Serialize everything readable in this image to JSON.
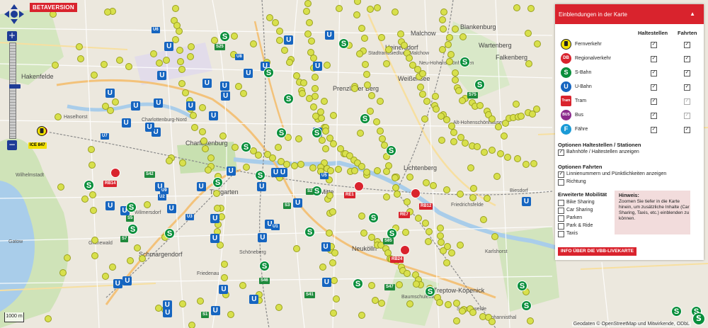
{
  "badge": "BETAVERSION",
  "scale_label": "1000 m",
  "attribution": "Geodaten © OpenStreetMap und Mitwirkende, ODbL",
  "zoom": {
    "in": "+",
    "out": "−"
  },
  "panel": {
    "title": "Einblendungen in der Karte",
    "col_stops": "Haltestellen",
    "col_trips": "Fahrten",
    "modes": [
      {
        "label": "Fernverkehr",
        "icon": "ice-icon",
        "glyph": "",
        "color": "#f2e000",
        "stops": true,
        "trips": true,
        "trips_dim": false
      },
      {
        "label": "Regionalverkehr",
        "icon": "regional-train-icon",
        "glyph": "DB",
        "color": "#d9232d",
        "stops": true,
        "trips": true,
        "trips_dim": false
      },
      {
        "label": "S-Bahn",
        "icon": "s-bahn-icon",
        "glyph": "S",
        "color": "#0a8f3c",
        "stops": true,
        "trips": true,
        "trips_dim": false
      },
      {
        "label": "U-Bahn",
        "icon": "u-bahn-icon",
        "glyph": "U",
        "color": "#1665c0",
        "stops": true,
        "trips": true,
        "trips_dim": false
      },
      {
        "label": "Tram",
        "icon": "tram-icon",
        "glyph": "Tram",
        "color": "#d9232d",
        "stops": true,
        "trips": true,
        "trips_dim": true
      },
      {
        "label": "Bus",
        "icon": "bus-icon",
        "glyph": "BUS",
        "color": "#8b2a8c",
        "stops": true,
        "trips": true,
        "trips_dim": true
      },
      {
        "label": "Fähre",
        "icon": "ferry-icon",
        "glyph": "F",
        "color": "#1a9ad6",
        "stops": true,
        "trips": true,
        "trips_dim": false
      }
    ],
    "stops_section": "Optionen Haltestellen / Stationen",
    "stops_option": "Bahnhöfe / Haltestellen anzeigen",
    "trips_section": "Optionen Fahrten",
    "trips_options": [
      "Linnienummern und Pünktlichkeiten anzeigen",
      "Richtung"
    ],
    "trips_checked": [
      true,
      false
    ],
    "mobility_section": "Erweiterte Mobilität",
    "mobility_options": [
      "Bike Sharing",
      "Car Sharing",
      "Parken",
      "Park & Ride",
      "Taxis"
    ],
    "hint_title": "Hinweis:",
    "hint_text": "Zoomen Sie tiefer in die Karte hinein, um zusätzliche Inhalte (Car Sharing, Taxis, etc.) einblenden zu können.",
    "info_button": "INFO ÜBER DIE VBB-LIVEKARTE"
  },
  "map_labels": [
    "Hakenfelde",
    "Haselhorst",
    "Charlottenburg-Nord",
    "Wilhelmstadt",
    "Charlottenburg",
    "Gatow",
    "Grunewald",
    "Schmargendorf",
    "Friedenau",
    "Schöneberg",
    "Tiergarten",
    "Mitte",
    "Prenzlauer Berg",
    "Weißensee",
    "Heinersdorf",
    "Blankenburg",
    "Malchow",
    "Wartenberg",
    "Falkenberg",
    "Lichtenberg",
    "Friedrichsfelde",
    "Biesdorf",
    "Neu-Hohenschönhausen",
    "Treptow-Köpenick",
    "Baumschulenweg",
    "Schöneweide",
    "Neukölln",
    "Johannisthal",
    "Stadtrandsiedlung Malchow",
    "Wilmersdorf",
    "Alt-Hohenschönhausen",
    "Karlshorst"
  ],
  "line_chips": [
    {
      "t": "U6",
      "k": "u"
    },
    {
      "t": "U8",
      "k": "u"
    },
    {
      "t": "S25",
      "k": "s"
    },
    {
      "t": "U7",
      "k": "u"
    },
    {
      "t": "S75",
      "k": "s"
    },
    {
      "t": "S42",
      "k": "s"
    },
    {
      "t": "S41",
      "k": "s"
    },
    {
      "t": "S46",
      "k": "s"
    },
    {
      "t": "S5",
      "k": "s"
    },
    {
      "t": "S7",
      "k": "s"
    },
    {
      "t": "U2",
      "k": "u"
    },
    {
      "t": "U5",
      "k": "u"
    },
    {
      "t": "U3",
      "k": "u"
    },
    {
      "t": "U9",
      "k": "u"
    },
    {
      "t": "S1",
      "k": "s"
    },
    {
      "t": "S85",
      "k": "s"
    },
    {
      "t": "S47",
      "k": "s"
    },
    {
      "t": "S3",
      "k": "s"
    },
    {
      "t": "U1",
      "k": "u"
    },
    {
      "t": "S2",
      "k": "s"
    },
    {
      "t": "RB14",
      "k": "re"
    },
    {
      "t": "RE1",
      "k": "re"
    },
    {
      "t": "RE7",
      "k": "re"
    },
    {
      "t": "RB12",
      "k": "re"
    },
    {
      "t": "RB24",
      "k": "re"
    },
    {
      "t": "ICE 847",
      "k": "ice"
    }
  ]
}
